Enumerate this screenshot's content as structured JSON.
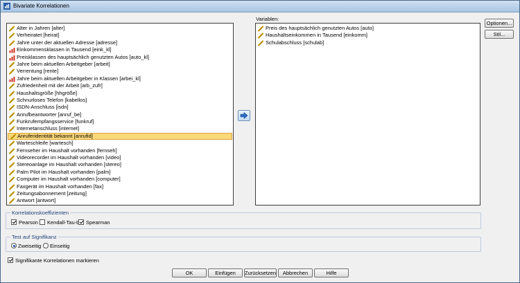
{
  "window": {
    "title": "Bivariate Korrelationen"
  },
  "source_list": {
    "items": [
      {
        "label": "Alter in Jahren [alter]",
        "icon": "scale-icon"
      },
      {
        "label": "Verheiratet [heirat]",
        "icon": "scale-icon"
      },
      {
        "label": "Jahre unter der aktuellen Adresse [adresse]",
        "icon": "scale-icon"
      },
      {
        "label": "Einkommensklassen in Tausend [eink_kl]",
        "icon": "ordinal-icon"
      },
      {
        "label": "Preisklassen des hauptsächlich genutzten Autos [auto_kl]",
        "icon": "ordinal-icon"
      },
      {
        "label": "Jahre beim aktuellen Arbeitgeber [arbeit]",
        "icon": "scale-icon"
      },
      {
        "label": "Verrentung [rente]",
        "icon": "scale-icon"
      },
      {
        "label": "Jahre beim aktuellen Arbeitgeber in Klassen [arbei_kl]",
        "icon": "ordinal-icon"
      },
      {
        "label": "Zufriedenheit mit der Arbeit [arb_zufr]",
        "icon": "scale-icon"
      },
      {
        "label": "Haushaltsgröße [hhgröße]",
        "icon": "scale-icon"
      },
      {
        "label": "Schnurloses Telefon [kabellos]",
        "icon": "scale-icon"
      },
      {
        "label": "ISDN-Anschluss [isdn]",
        "icon": "scale-icon"
      },
      {
        "label": "Anrufbeantworter [anruf_be]",
        "icon": "scale-icon"
      },
      {
        "label": "Funkrufempfangsservice [funkruf]",
        "icon": "scale-icon"
      },
      {
        "label": "Internetanschluss [internet]",
        "icon": "scale-icon"
      },
      {
        "label": "Anruferidentität bekannt [anrufid]",
        "icon": "scale-icon",
        "selected": true
      },
      {
        "label": "Warteschleife [wartesch]",
        "icon": "scale-icon"
      },
      {
        "label": "Fernseher im Haushalt vorhanden [fernseh]",
        "icon": "scale-icon"
      },
      {
        "label": "Videorecorder im Haushalt vorhanden [video]",
        "icon": "scale-icon"
      },
      {
        "label": "Stereoanlage im Haushalt vorhanden [stereo]",
        "icon": "scale-icon"
      },
      {
        "label": "Palm Pilot im Haushalt vorhanden [palm]",
        "icon": "scale-icon"
      },
      {
        "label": "Computer im Haushalt vorhanden [computer]",
        "icon": "scale-icon"
      },
      {
        "label": "Faxgerät im Haushalt vorhanden [fax]",
        "icon": "scale-icon"
      },
      {
        "label": "Zeitungsabonnement [zeitung]",
        "icon": "scale-icon"
      },
      {
        "label": "Antwort [antwort]",
        "icon": "scale-icon"
      }
    ]
  },
  "move_button": {
    "icon": "arrow-right-icon"
  },
  "target": {
    "label": "Variablen:",
    "items": [
      {
        "label": "Preis des hauptsächlich genutzten Autos [auto]",
        "icon": "scale-icon"
      },
      {
        "label": "Haushaltseinkommen in Tausend [einkomm]",
        "icon": "scale-icon"
      },
      {
        "label": "Schulabschluss [schulab]",
        "icon": "scale-icon"
      }
    ]
  },
  "side_buttons": {
    "options": "Optionen...",
    "style": "Stil..."
  },
  "coefficients": {
    "title": "Korrelationskoeffizienten",
    "pearson": {
      "label": "Pearson",
      "checked": true
    },
    "kendall": {
      "label": "Kendall-Tau-b",
      "checked": false
    },
    "spearman": {
      "label": "Spearman",
      "checked": true
    }
  },
  "significance": {
    "title": "Test auf Signifikanz",
    "two_tailed": {
      "label": "Zweiseitig",
      "selected": true
    },
    "one_tailed": {
      "label": "Einseitig",
      "selected": false
    }
  },
  "flag": {
    "label": "Signifikante Korrelationen markieren",
    "checked": true
  },
  "footer": {
    "ok": "OK",
    "paste": "Einfügen",
    "reset": "Zurücksetzen",
    "cancel": "Abbrechen",
    "help": "Hilfe"
  },
  "colors": {
    "selection": "#fbd87a",
    "scale_icon": "#c49a00",
    "ordinal_bars": "#d03020"
  }
}
